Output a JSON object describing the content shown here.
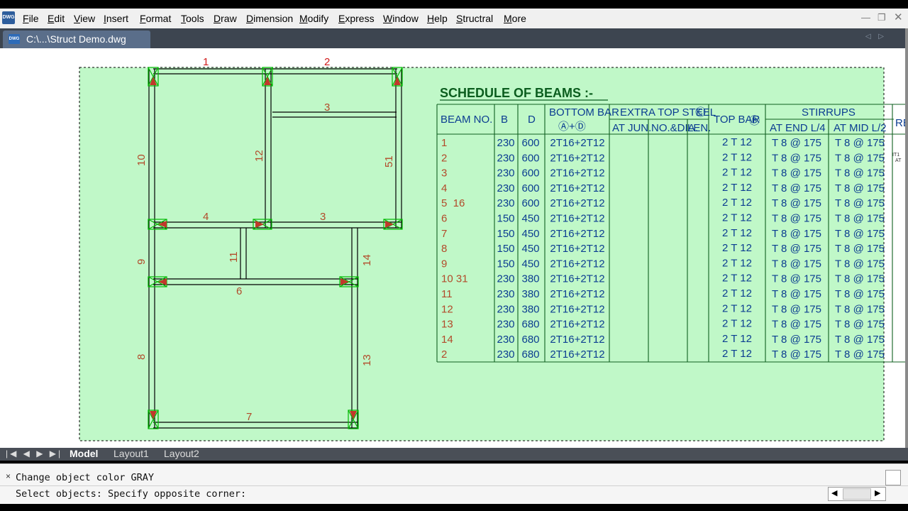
{
  "menu": {
    "items": [
      "File",
      "Edit",
      "View",
      "Insert",
      "Format",
      "Tools",
      "Draw",
      "Dimension",
      "Modify",
      "Express",
      "Window",
      "Help",
      "Structral",
      "More"
    ],
    "app_logo": "DWG"
  },
  "doc_tab": {
    "label": "C:\\...\\Struct Demo.dwg",
    "icon_text": "DWG"
  },
  "plan": {
    "beam_labels": [
      "1",
      "2",
      "3",
      "3",
      "4",
      "6",
      "7",
      "10",
      "12",
      "51",
      "9",
      "11",
      "14",
      "8",
      "13"
    ],
    "extra_labels": [
      "16",
      "31"
    ]
  },
  "schedule": {
    "title": "SCHEDULE OF BEAMS :-",
    "headers": {
      "beam_no": "BEAM NO.",
      "b": "B",
      "d": "D",
      "bottom_bar": "BOTTOM BAR",
      "bottom_sub": "Ⓐ+Ⓓ",
      "extra_top": "EXTRA TOP STEEL",
      "extra_top_circle": "Ⓒ",
      "at_jun": "AT JUN.",
      "no_dia": "NO.&DIA.",
      "len": "LEN.",
      "top_bar": "TOP BAR",
      "top_bar_circle": "Ⓑ",
      "stirrups": "STIRRUPS",
      "at_end": "AT END L/4",
      "at_mid": "AT MID L/2",
      "rem": "RE"
    },
    "rows": [
      {
        "no": "1",
        "b": "230",
        "d": "600",
        "bottom": "2T16+2T12",
        "top": "2 T 12",
        "end": "T 8 @ 175",
        "mid": "T 8 @ 175"
      },
      {
        "no": "2",
        "b": "230",
        "d": "600",
        "bottom": "2T16+2T12",
        "top": "2 T 12",
        "end": "T 8 @ 175",
        "mid": "T 8 @ 175"
      },
      {
        "no": "3",
        "b": "230",
        "d": "600",
        "bottom": "2T16+2T12",
        "top": "2 T 12",
        "end": "T 8 @ 175",
        "mid": "T 8 @ 175"
      },
      {
        "no": "4",
        "b": "230",
        "d": "600",
        "bottom": "2T16+2T12",
        "top": "2 T 12",
        "end": "T 8 @ 175",
        "mid": "T 8 @ 175"
      },
      {
        "no": "5  16",
        "b": "230",
        "d": "600",
        "bottom": "2T16+2T12",
        "top": "2 T 12",
        "end": "T 8 @ 175",
        "mid": "T 8 @ 175"
      },
      {
        "no": "6",
        "b": "150",
        "d": "450",
        "bottom": "2T16+2T12",
        "top": "2 T 12",
        "end": "T 8 @ 175",
        "mid": "T 8 @ 175"
      },
      {
        "no": "7",
        "b": "150",
        "d": "450",
        "bottom": "2T16+2T12",
        "top": "2 T 12",
        "end": "T 8 @ 175",
        "mid": "T 8 @ 175"
      },
      {
        "no": "8",
        "b": "150",
        "d": "450",
        "bottom": "2T16+2T12",
        "top": "2 T 12",
        "end": "T 8 @ 175",
        "mid": "T 8 @ 175"
      },
      {
        "no": "9",
        "b": "150",
        "d": "450",
        "bottom": "2T16+2T12",
        "top": "2 T 12",
        "end": "T 8 @ 175",
        "mid": "T 8 @ 175"
      },
      {
        "no": "10 31",
        "b": "230",
        "d": "380",
        "bottom": "2T16+2T12",
        "top": "2 T 12",
        "end": "T 8 @ 175",
        "mid": "T 8 @ 175"
      },
      {
        "no": "11",
        "b": "230",
        "d": "380",
        "bottom": "2T16+2T12",
        "top": "2 T 12",
        "end": "T 8 @ 175",
        "mid": "T 8 @ 175"
      },
      {
        "no": "12",
        "b": "230",
        "d": "380",
        "bottom": "2T16+2T12",
        "top": "2 T 12",
        "end": "T 8 @ 175",
        "mid": "T 8 @ 175"
      },
      {
        "no": "13",
        "b": "230",
        "d": "680",
        "bottom": "2T16+2T12",
        "top": "2 T 12",
        "end": "T 8 @ 175",
        "mid": "T 8 @ 175"
      },
      {
        "no": "14",
        "b": "230",
        "d": "680",
        "bottom": "2T16+2T12",
        "top": "2 T 12",
        "end": "T 8 @ 175",
        "mid": "T 8 @ 175"
      },
      {
        "no": "2",
        "b": "230",
        "d": "680",
        "bottom": "2T16+2T12",
        "top": "2 T 12",
        "end": "T 8 @ 175",
        "mid": "T 8 @ 175"
      }
    ],
    "remark_fragment": "IT1\nAT"
  },
  "layout_tabs": {
    "nav": "|◀ ◀ ▶ ▶|",
    "model": "Model",
    "layout1": "Layout1",
    "layout2": "Layout2"
  },
  "command": {
    "history": "Change object color GRAY",
    "prompt": "Select objects: Specify opposite corner:",
    "close_glyph": "×"
  },
  "colors": {
    "selection_fill": "#c0f8c8",
    "beam_label_red": "#d11b1b",
    "beam_label_brown": "#b24a2a",
    "table_text_blue": "#0b3d91",
    "grid_green": "#106020"
  }
}
